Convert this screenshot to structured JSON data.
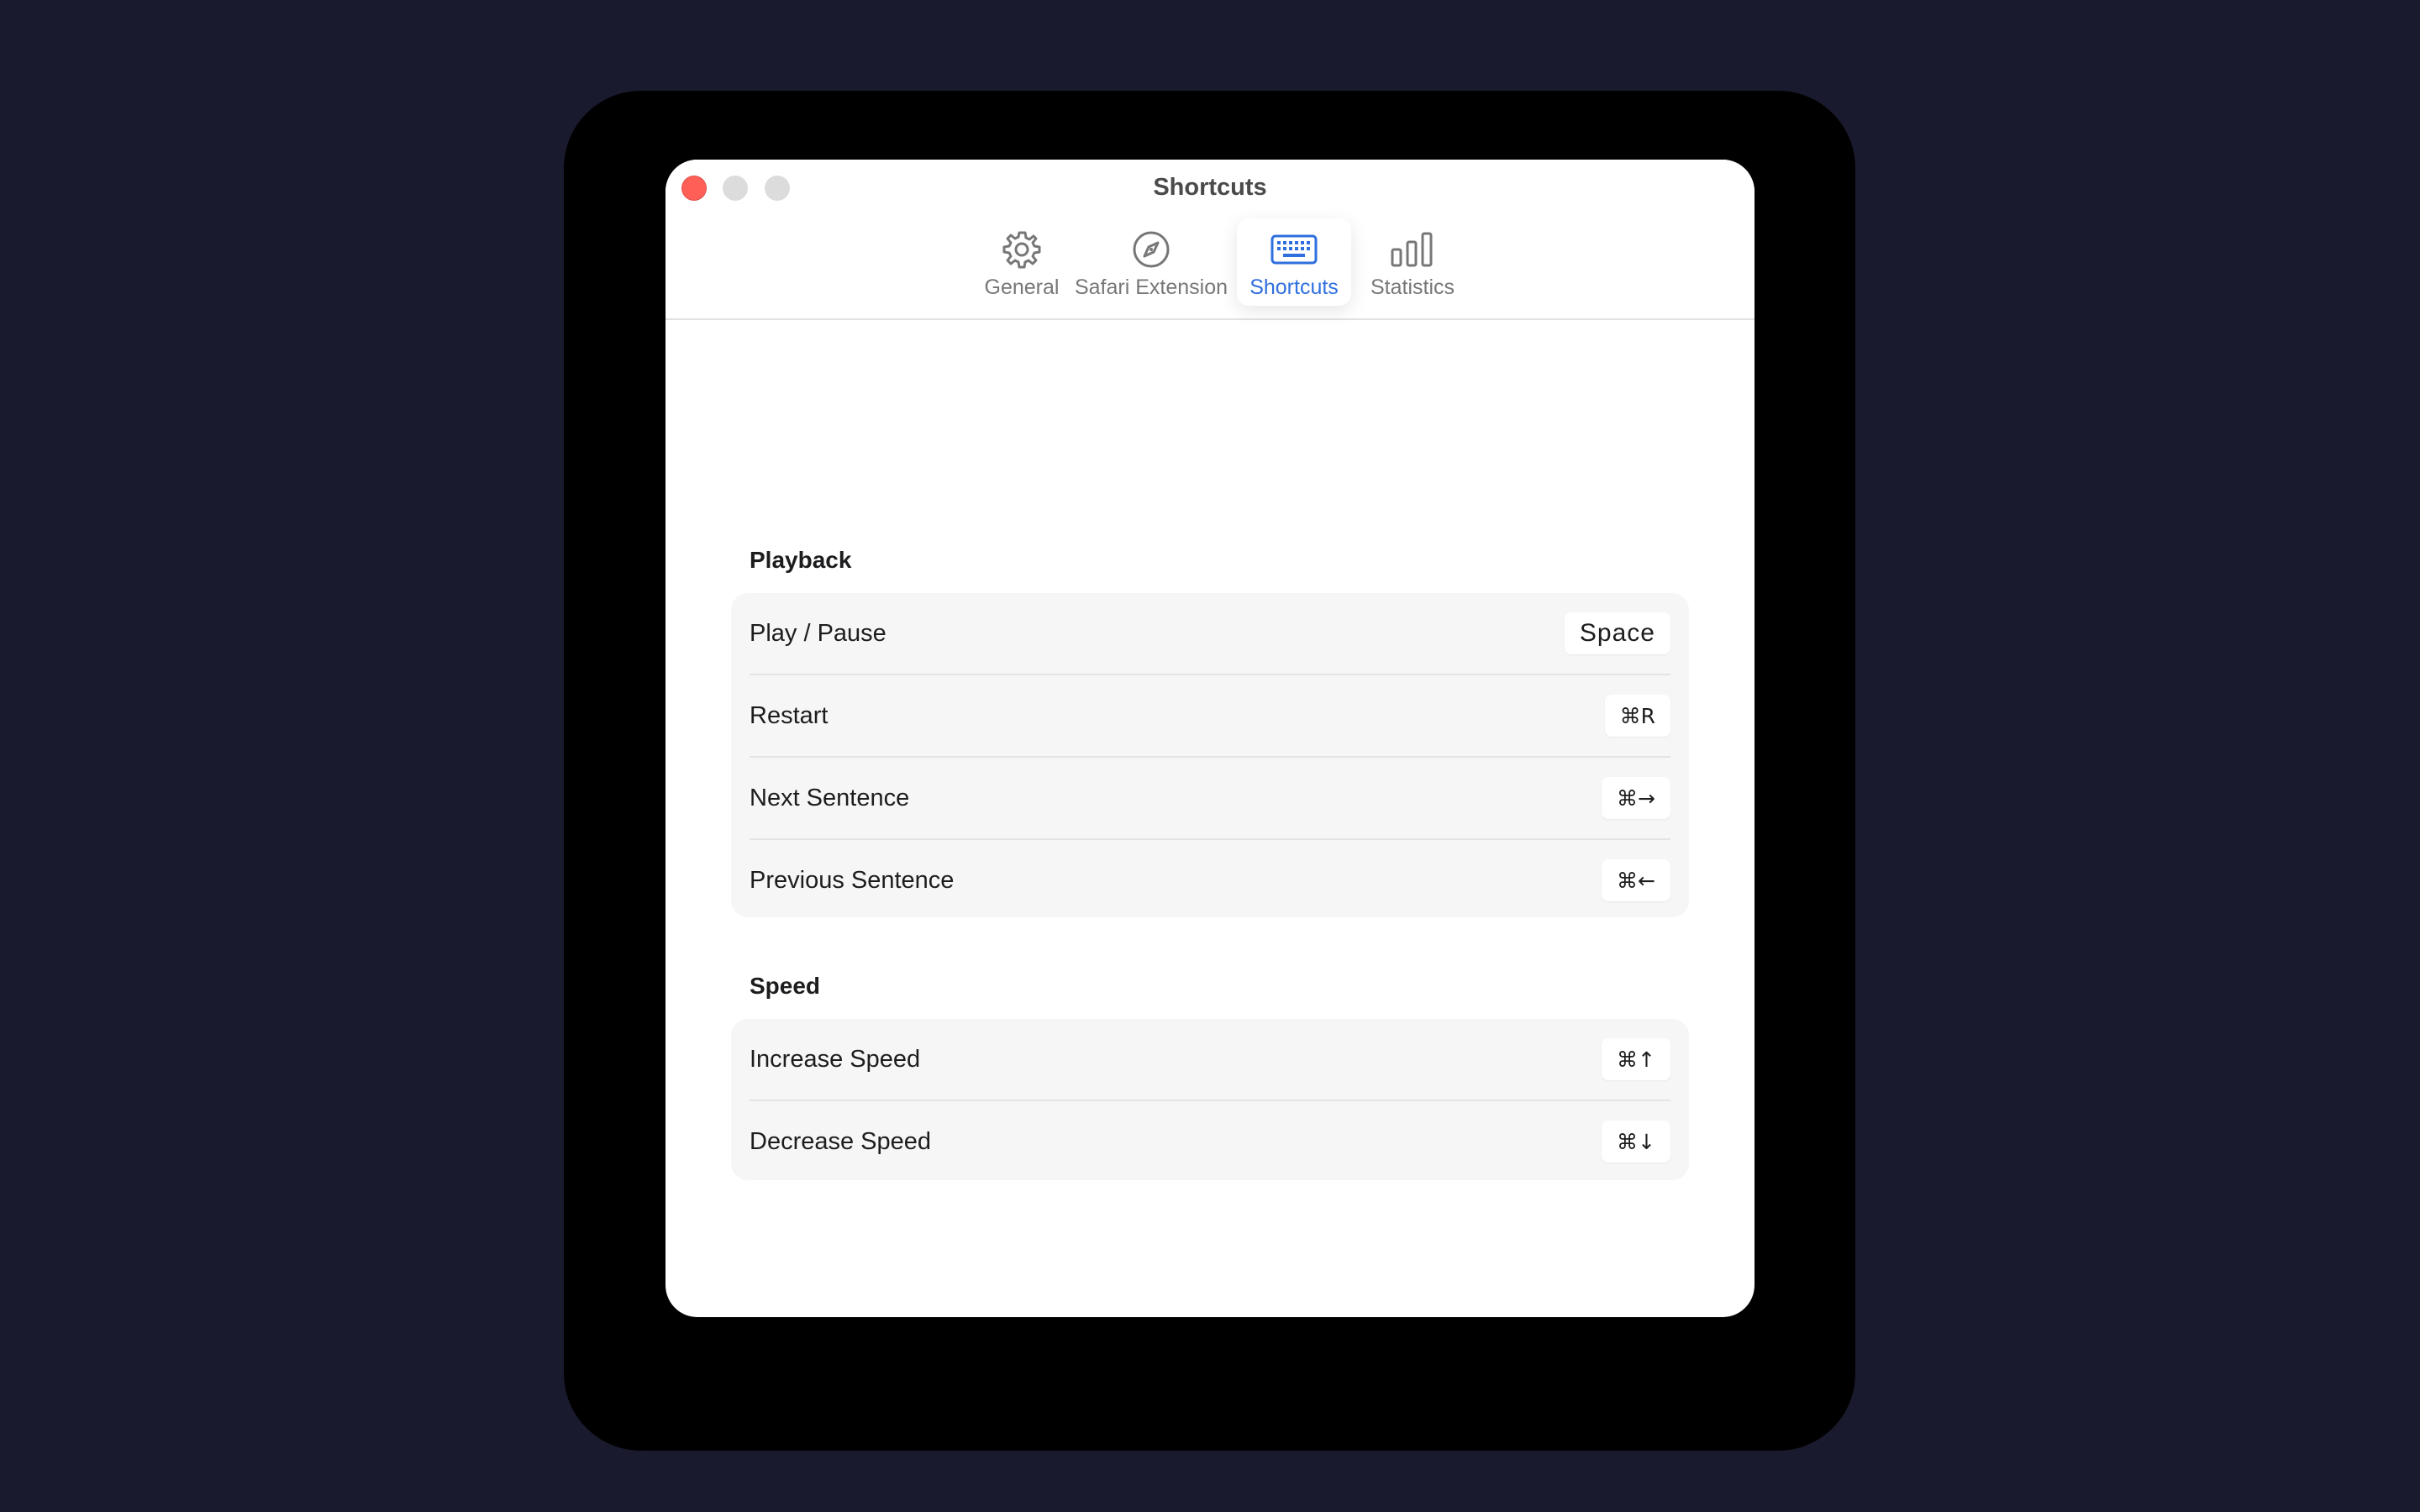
{
  "window": {
    "title": "Shortcuts"
  },
  "tabs": [
    {
      "label": "General",
      "icon": "gear-icon",
      "active": false
    },
    {
      "label": "Safari Extension",
      "icon": "compass-icon",
      "active": false
    },
    {
      "label": "Shortcuts",
      "icon": "keyboard-icon",
      "active": true
    },
    {
      "label": "Statistics",
      "icon": "bar-chart-icon",
      "active": false
    }
  ],
  "sections": {
    "playback": {
      "title": "Playback",
      "rows": [
        {
          "label": "Play / Pause",
          "key": "Space"
        },
        {
          "label": "Restart",
          "key": "⌘R"
        },
        {
          "label": "Next Sentence",
          "key": "⌘→"
        },
        {
          "label": "Previous Sentence",
          "key": "⌘←"
        }
      ]
    },
    "speed": {
      "title": "Speed",
      "rows": [
        {
          "label": "Increase Speed",
          "key": "⌘↑"
        },
        {
          "label": "Decrease Speed",
          "key": "⌘↓"
        }
      ]
    }
  },
  "colors": {
    "accent": "#2f6fde",
    "close_button": "#ff5f57",
    "background": "#1a1a2e"
  }
}
